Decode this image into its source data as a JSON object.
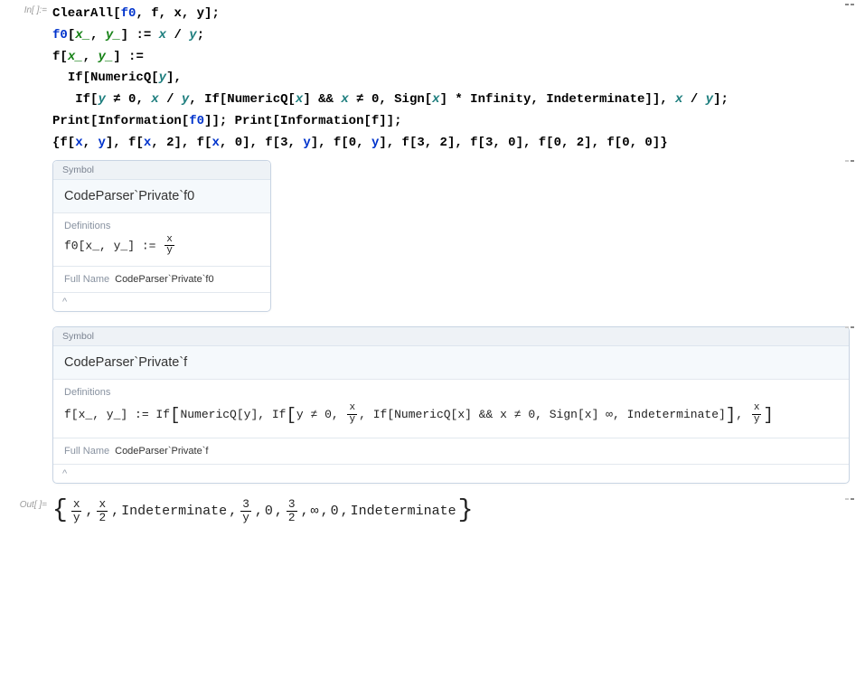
{
  "in_label": "In[  ]:=",
  "out_label": "Out[  ]=",
  "code": {
    "t1a": "ClearAll",
    "t1b": "[",
    "t1c": "f0",
    "t1d": ", f, x, y];",
    "t2a": "f0",
    "t2b": "[",
    "t2c": "x_",
    "t2d": ", ",
    "t2e": "y_",
    "t2f": "] := ",
    "t2g": "x",
    "t2h": " / ",
    "t2i": "y",
    "t2j": ";",
    "t3a": "f[",
    "t3b": "x_",
    "t3c": ", ",
    "t3d": "y_",
    "t3e": "] :=",
    "t4a": "  If[NumericQ[",
    "t4b": "y",
    "t4c": "],",
    "t5a": "   If[",
    "t5b": "y",
    "t5c": " ≠ 0, ",
    "t5d": "x",
    "t5e": " / ",
    "t5f": "y",
    "t5g": ", If[NumericQ[",
    "t5h": "x",
    "t5i": "] && ",
    "t5j": "x",
    "t5k": " ≠ 0, Sign[",
    "t5l": "x",
    "t5m": "] * Infinity, Indeterminate]], ",
    "t5n": "x",
    "t5o": " / ",
    "t5p": "y",
    "t5q": "];",
    "t6a": "Print[Information[",
    "t6b": "f0",
    "t6c": "]]; Print[Information[f]];",
    "t7a": "{f[",
    "t7b": "x",
    "t7c": ", ",
    "t7d": "y",
    "t7e": "], f[",
    "t7f": "x",
    "t7g": ", 2], f[",
    "t7h": "x",
    "t7i": ", 0], f[3, ",
    "t7j": "y",
    "t7k": "], f[0, ",
    "t7l": "y",
    "t7m": "], f[3, 2], f[3, 0], f[0, 2], f[0, 0]}"
  },
  "panel_labels": {
    "symbol": "Symbol",
    "definitions": "Definitions",
    "full_name_label": "Full Name",
    "caret": "^"
  },
  "panel1": {
    "title": "CodeParser`Private`f0",
    "def_prefix": "f0[x_, y_] := ",
    "def_num": "x",
    "def_den": "y",
    "full_name": "CodeParser`Private`f0"
  },
  "panel2": {
    "title": "CodeParser`Private`f",
    "def_a": "f[x_, y_] := If",
    "def_b": "NumericQ[y], If",
    "def_c": "y ≠ 0, ",
    "frac1_num": "x",
    "frac1_den": "y",
    "def_d": ", If[NumericQ[x] && x ≠ 0, Sign[x] ∞, Indeterminate]",
    "def_e": ", ",
    "frac2_num": "x",
    "frac2_den": "y",
    "full_name": "CodeParser`Private`f"
  },
  "output": {
    "open": "{",
    "close": "}",
    "f1n": "x",
    "f1d": "y",
    "sep": ", ",
    "f2n": "x",
    "f2d": "2",
    "t_indet": "Indeterminate",
    "f3n": "3",
    "f3d": "y",
    "t_zero": "0",
    "f4n": "3",
    "f4d": "2",
    "t_inf": "∞"
  }
}
